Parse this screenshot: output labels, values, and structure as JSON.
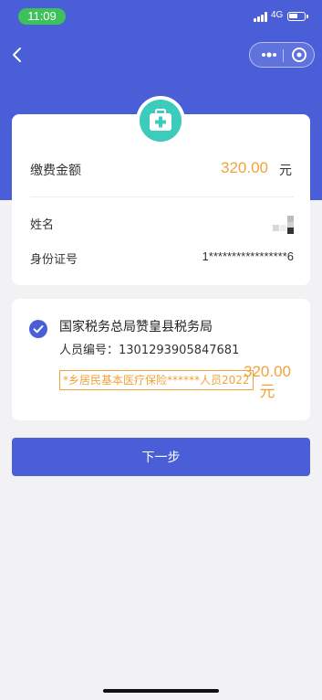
{
  "status_bar": {
    "time": "11:09",
    "network": "4G"
  },
  "payment": {
    "amount_label": "缴费金额",
    "amount_value": "320.00",
    "amount_unit": "元",
    "name_label": "姓名",
    "id_label": "身份证号",
    "id_value": "1*****************6"
  },
  "item": {
    "bureau": "国家税务总局赞皇县税务局",
    "person_id": "人员编号：1301293905847681",
    "insurance": "*乡居民基本医疗保险******人员2022",
    "amount_value": "320.00",
    "amount_unit": "元"
  },
  "next_button_label": "下一步",
  "colors": {
    "brand_blue": "#4a5fd7",
    "accent_orange": "#f0a33a",
    "icon_teal": "#3ccbbd",
    "time_green": "#3ec05a"
  }
}
